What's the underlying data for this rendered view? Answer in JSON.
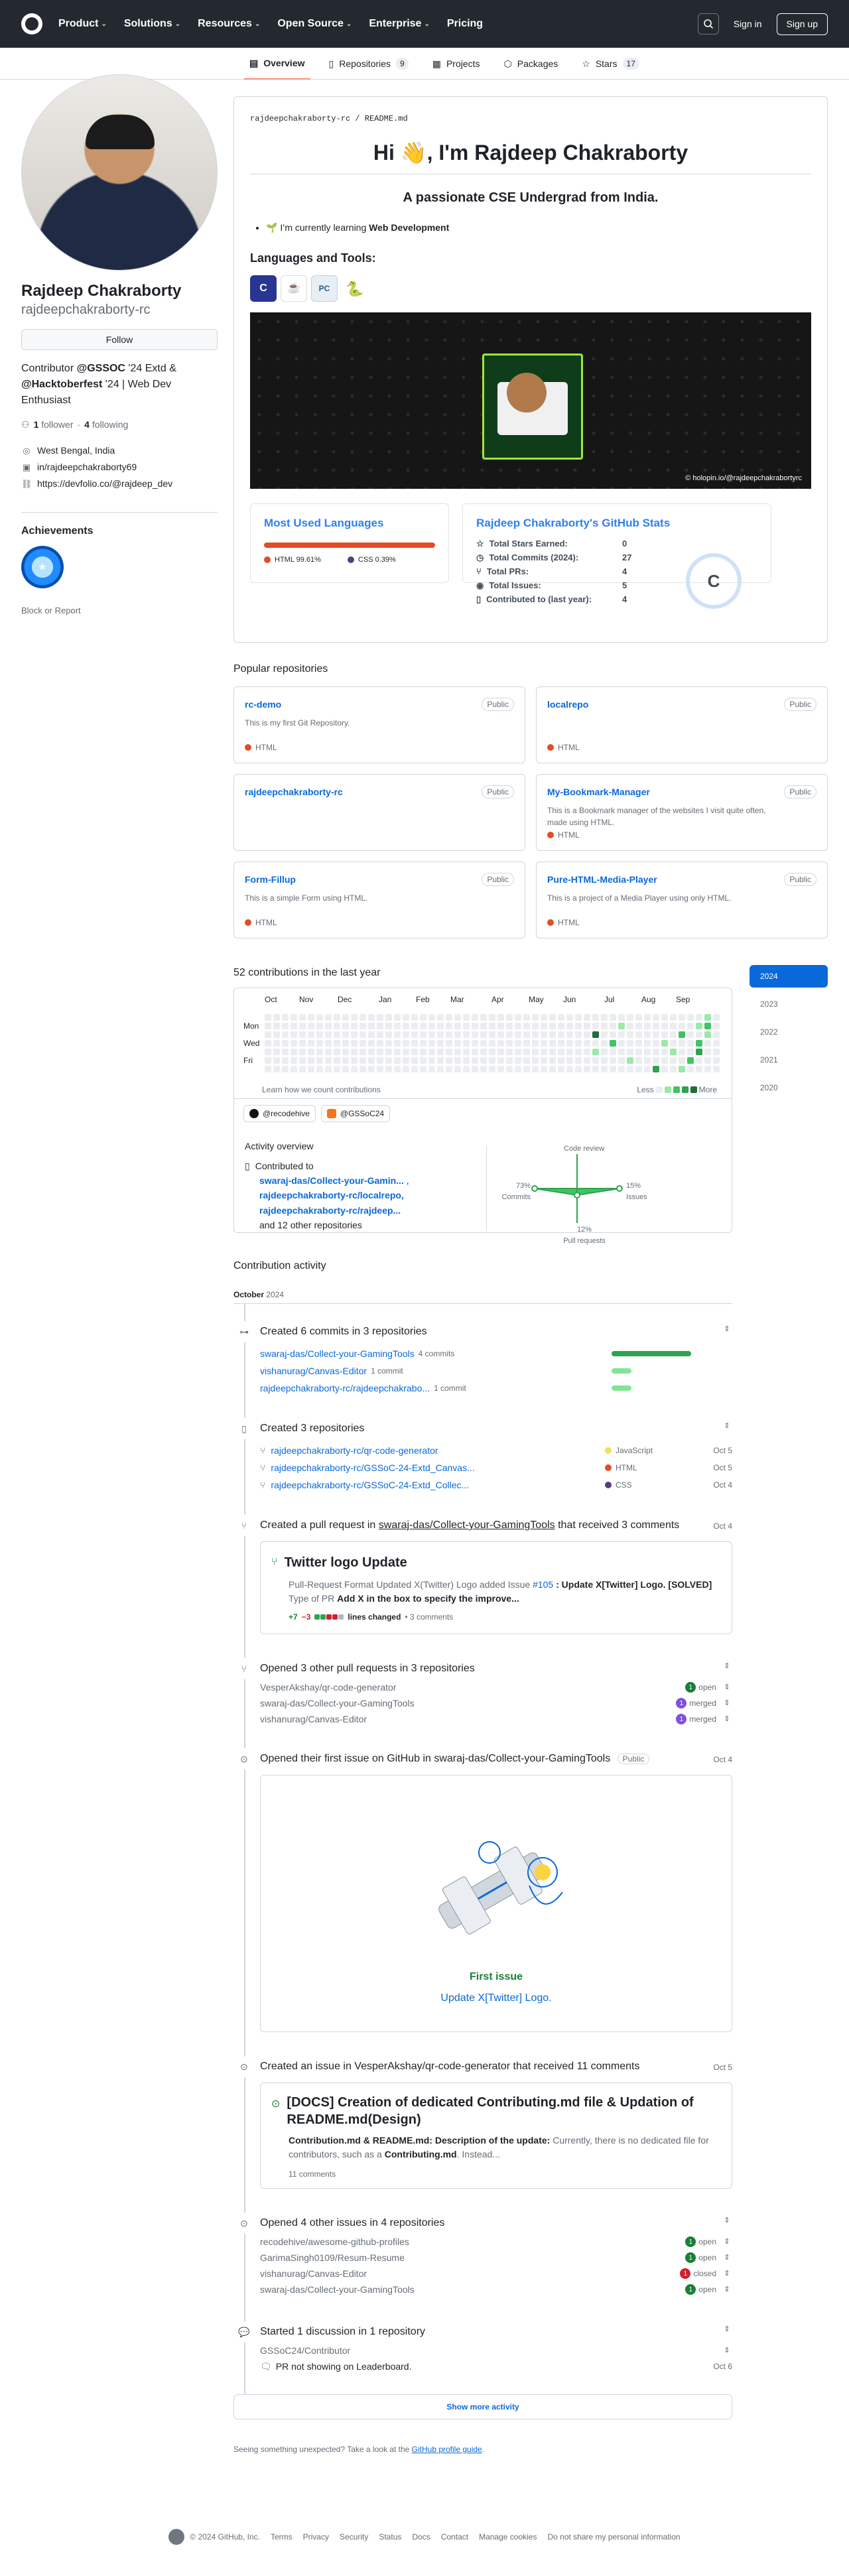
{
  "header": {
    "nav": [
      "Product",
      "Solutions",
      "Resources",
      "Open Source",
      "Enterprise",
      "Pricing"
    ],
    "sign_in": "Sign in",
    "sign_up": "Sign up"
  },
  "tabs": [
    {
      "label": "Overview",
      "count": ""
    },
    {
      "label": "Repositories",
      "count": "9"
    },
    {
      "label": "Projects",
      "count": ""
    },
    {
      "label": "Packages",
      "count": ""
    },
    {
      "label": "Stars",
      "count": "17"
    }
  ],
  "profile": {
    "name": "Rajdeep Chakraborty",
    "login": "rajdeepchakraborty-rc",
    "follow_label": "Follow",
    "bio_1": "Contributor ",
    "bio_gssoc": "@GSSOC",
    "bio_2": " '24 Extd & ",
    "bio_hack": "@Hacktoberfest",
    "bio_3": " '24 | Web Dev Enthusiast",
    "followers_count": "1",
    "followers_label": "follower",
    "following_count": "4",
    "following_label": "following",
    "location": "West Bengal, India",
    "linkedin": "in/rajdeepchakraborty69",
    "website": "https://devfolio.co/@rajdeep_dev",
    "achievements_title": "Achievements",
    "block_report": "Block or Report"
  },
  "readme": {
    "path_user": "rajdeepchakraborty-rc",
    "path_file": "README.md",
    "heading": "Hi 👋, I'm Rajdeep Chakraborty",
    "subheading": "A passionate CSE Undergrad from India.",
    "learning_prefix": "🌱 I’m currently learning ",
    "learning_bold": "Web Development",
    "tools_title": "Languages and Tools:",
    "banner_credit": "© holopin.io/@rajdeepchakrabortyrc",
    "langs_card": {
      "title": "Most Used Languages",
      "items": [
        {
          "name": "HTML",
          "pct": "99.61%",
          "color": "#e34c26"
        },
        {
          "name": "CSS",
          "pct": "0.39%",
          "color": "#563d7c"
        }
      ]
    },
    "stats_card": {
      "title": "Rajdeep Chakraborty's GitHub Stats",
      "rows": [
        {
          "label": "Total Stars Earned:",
          "value": "0"
        },
        {
          "label": "Total Commits (2024):",
          "value": "27"
        },
        {
          "label": "Total PRs:",
          "value": "4"
        },
        {
          "label": "Total Issues:",
          "value": "5"
        },
        {
          "label": "Contributed to (last year):",
          "value": "4"
        }
      ],
      "rank": "C"
    }
  },
  "popular": {
    "title": "Popular repositories",
    "repos": [
      {
        "name": "rc-demo",
        "desc": "This is my first Git Repository.",
        "lang": "HTML",
        "visibility": "Public"
      },
      {
        "name": "localrepo",
        "desc": "",
        "lang": "HTML",
        "visibility": "Public"
      },
      {
        "name": "rajdeepchakraborty-rc",
        "desc": "",
        "lang": "",
        "visibility": "Public"
      },
      {
        "name": "My-Bookmark-Manager",
        "desc": "This is a Bookmark manager of the websites I visit quite often, made using HTML.",
        "lang": "HTML",
        "visibility": "Public"
      },
      {
        "name": "Form-Fillup",
        "desc": "This is a simple Form using HTML.",
        "lang": "HTML",
        "visibility": "Public"
      },
      {
        "name": "Pure-HTML-Media-Player",
        "desc": "This is a project of a Media Player using only HTML.",
        "lang": "HTML",
        "visibility": "Public"
      }
    ]
  },
  "contributions": {
    "title": "52 contributions in the last year",
    "months": [
      "Oct",
      "Nov",
      "Dec",
      "Jan",
      "Feb",
      "Mar",
      "Apr",
      "May",
      "Jun",
      "Jul",
      "Aug",
      "Sep"
    ],
    "days": [
      "Mon",
      "Wed",
      "Fri"
    ],
    "note": "Learn how we count contributions",
    "less": "Less",
    "more": "More",
    "years": [
      "2024",
      "2023",
      "2022",
      "2021",
      "2020"
    ],
    "orgs": [
      "@recodehive",
      "@GSSoC24"
    ],
    "activity_overview": "Activity overview",
    "contributed_to": "Contributed to",
    "repos": [
      "swaraj-das/Collect-your-Gamin...",
      "rajdeepchakraborty-rc/localrepo,",
      "rajdeepchakraborty-rc/rajdeep..."
    ],
    "others": "and 12 other repositories",
    "axes": {
      "code_review": "Code review",
      "issues": "Issues",
      "pull_requests": "Pull requests",
      "commits": "Commits"
    },
    "percents": {
      "commits": "73%",
      "issues": "15%",
      "pull_requests": "12%"
    }
  },
  "activity": {
    "title": "Contribution activity",
    "month": "October",
    "year": "2024",
    "commits": {
      "title": "Created 6 commits in 3 repositories",
      "rows": [
        {
          "repo": "swaraj-das/Collect-your-GamingTools",
          "count": "4 commits"
        },
        {
          "repo": "vishanurag/Canvas-Editor",
          "count": "1 commit"
        },
        {
          "repo": "rajdeepchakraborty-rc/rajdeepchakrabo...",
          "count": "1 commit"
        }
      ]
    },
    "repos_created": {
      "title": "Created 3 repositories",
      "rows": [
        {
          "repo": "rajdeepchakraborty-rc/qr-code-generator",
          "lang": "JavaScript",
          "color": "#f1e05a",
          "date": "Oct 5"
        },
        {
          "repo": "rajdeepchakraborty-rc/GSSoC-24-Extd_Canvas...",
          "lang": "HTML",
          "color": "#e34c26",
          "date": "Oct 5"
        },
        {
          "repo": "rajdeepchakraborty-rc/GSSoC-24-Extd_Collec...",
          "lang": "CSS",
          "color": "#563d7c",
          "date": "Oct 4"
        }
      ]
    },
    "pr": {
      "prefix": "Created a pull request in ",
      "repo": "swaraj-das/Collect-your-GamingTools",
      "suffix": " that received 3 comments",
      "date": "Oct 4",
      "title": "Twitter logo Update",
      "body_1": "Pull-Request Format Updated X(Twitter) Logo added Issue ",
      "issue": "#105",
      "body_2": " : Update X[Twitter] Logo. [SOLVED]",
      "body_3": "Type of PR ",
      "body_4": "Add X in the box to specify the improve...",
      "additions": "+7",
      "deletions": "−3",
      "lines_changed": "lines changed",
      "comments": "• 3 comments"
    },
    "other_prs": {
      "title": "Opened 3 other pull requests in 3 repositories",
      "rows": [
        {
          "repo": "VesperAkshay/qr-code-generator",
          "count": "1",
          "state": "open"
        },
        {
          "repo": "swaraj-das/Collect-your-GamingTools",
          "count": "1",
          "state": "merged"
        },
        {
          "repo": "vishanurag/Canvas-Editor",
          "count": "1",
          "state": "merged"
        }
      ]
    },
    "first_issue": {
      "title": "Opened their first issue on GitHub in swaraj-das/Collect-your-GamingTools",
      "visibility": "Public",
      "date": "Oct 4",
      "label": "First issue",
      "link": "Update X[Twitter] Logo."
    },
    "issue": {
      "title": "Created an issue in VesperAkshay/qr-code-generator that received 11 comments",
      "date": "Oct 5",
      "heading": "[DOCS] Creation of dedicated Contributing.md file & Updation of README.md(Design)",
      "body_b": "Contribution.md & README.md: Description of the update:",
      "body": " Currently, there is no dedicated file for contributors, such as a ",
      "body_b2": "Contributing.md",
      "body_end": ". Instead...",
      "comments": "11 comments"
    },
    "other_issues": {
      "title": "Opened 4 other issues in 4 repositories",
      "rows": [
        {
          "repo": "recodehive/awesome-github-profiles",
          "count": "1",
          "state": "open"
        },
        {
          "repo": "GarimaSingh0109/Resum-Resume",
          "count": "1",
          "state": "open"
        },
        {
          "repo": "vishanurag/Canvas-Editor",
          "count": "1",
          "state": "closed"
        },
        {
          "repo": "swaraj-das/Collect-your-GamingTools",
          "count": "1",
          "state": "open"
        }
      ]
    },
    "discussion": {
      "title": "Started 1 discussion in 1 repository",
      "repo": "GSSoC24/Contributor",
      "item": "PR not showing on Leaderboard.",
      "date": "Oct 6"
    },
    "show_more": "Show more activity",
    "unexpected": "Seeing something unexpected? Take a look at the ",
    "guide": "GitHub profile guide",
    "guide_end": "."
  },
  "footer": [
    "© 2024 GitHub, Inc.",
    "Terms",
    "Privacy",
    "Security",
    "Status",
    "Docs",
    "Contact",
    "Manage cookies",
    "Do not share my personal information"
  ]
}
